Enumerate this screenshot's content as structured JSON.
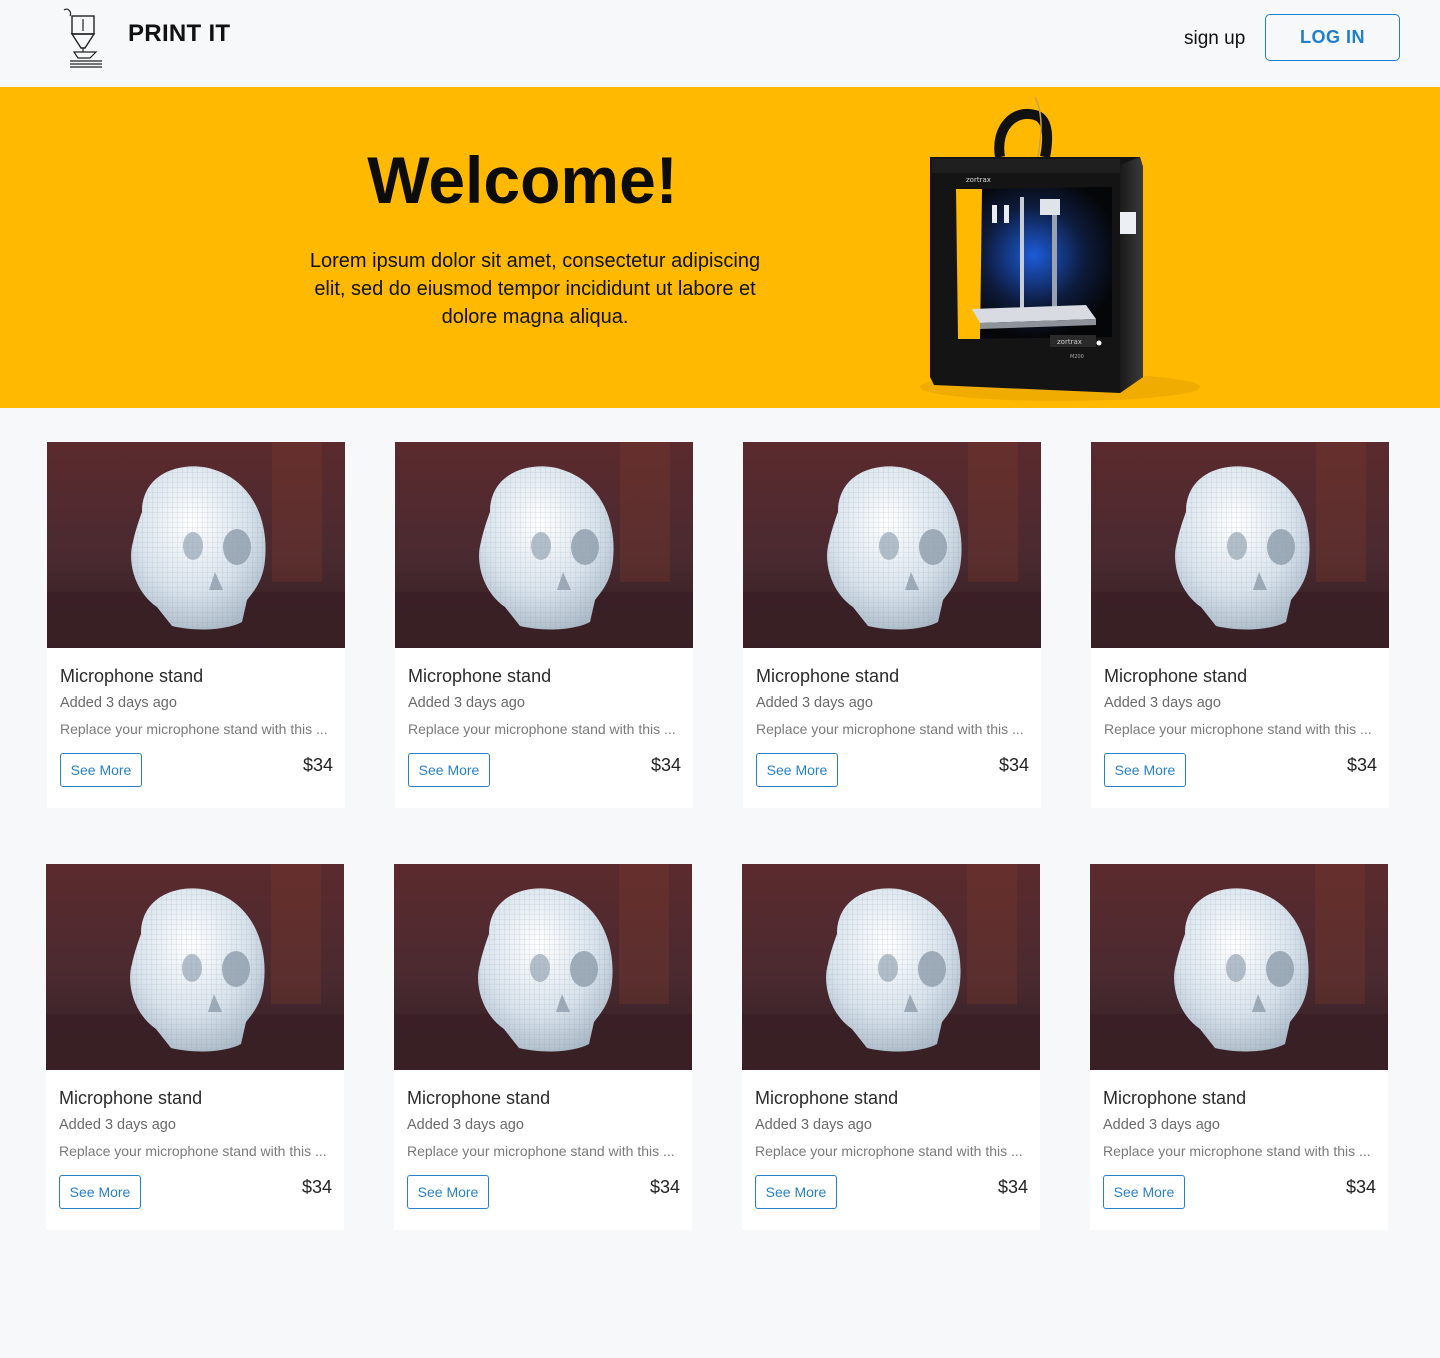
{
  "header": {
    "brand": "PRINT IT",
    "signup_label": "sign up",
    "login_label": "LOG IN",
    "logo_icon": "3d-printer-nozzle-icon"
  },
  "hero": {
    "title": "Welcome!",
    "text": "Lorem ipsum dolor sit amet, consectetur adipiscing elit, sed do eiusmod tempor incididunt ut labore et dolore magna aliqua.",
    "image": "3d-printer-image",
    "printer_labels": [
      "zortrax",
      "zortrax",
      "M200"
    ],
    "background_color": "#feb900"
  },
  "products": [
    {
      "title": "Microphone stand",
      "date": "Added 3 days ago",
      "desc": "Replace your microphone stand with this ...",
      "button": "See More",
      "price": "$34"
    },
    {
      "title": "Microphone stand",
      "date": "Added 3 days ago",
      "desc": "Replace your microphone stand with this ...",
      "button": "See More",
      "price": "$34"
    },
    {
      "title": "Microphone stand",
      "date": "Added 3 days ago",
      "desc": "Replace your microphone stand with this ...",
      "button": "See More",
      "price": "$34"
    },
    {
      "title": "Microphone stand",
      "date": "Added 3 days ago",
      "desc": "Replace your microphone stand with this ...",
      "button": "See More",
      "price": "$34"
    },
    {
      "title": "Microphone stand",
      "date": "Added 3 days ago",
      "desc": "Replace your microphone stand with this ...",
      "button": "See More",
      "price": "$34"
    },
    {
      "title": "Microphone stand",
      "date": "Added 3 days ago",
      "desc": "Replace your microphone stand with this ...",
      "button": "See More",
      "price": "$34"
    },
    {
      "title": "Microphone stand",
      "date": "Added 3 days ago",
      "desc": "Replace your microphone stand with this ...",
      "button": "See More",
      "price": "$34"
    },
    {
      "title": "Microphone stand",
      "date": "Added 3 days ago",
      "desc": "Replace your microphone stand with this ...",
      "button": "See More",
      "price": "$34"
    }
  ],
  "colors": {
    "accent": "#1e7fd0",
    "hero": "#feb900",
    "page_bg": "#f7f8fa"
  }
}
